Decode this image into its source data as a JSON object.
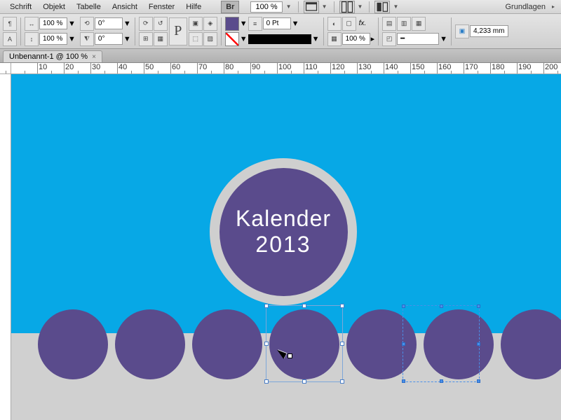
{
  "menu": {
    "items": [
      "Schrift",
      "Objekt",
      "Tabelle",
      "Ansicht",
      "Fenster",
      "Hilfe"
    ],
    "br": "Br",
    "zoom": "100 %",
    "workspace": "Grundlagen"
  },
  "ctrl": {
    "opacity_a": "100 %",
    "opacity_b": "100 %",
    "angle_a": "0°",
    "angle_b": "0°",
    "stroke_pt": "0 Pt",
    "obj_pct": "100 %",
    "dim": "4,233 mm"
  },
  "tab": {
    "name": "Unbenannt-1 @ 100 %",
    "close": "×"
  },
  "ruler": {
    "vals": [
      "",
      "",
      "10",
      "20",
      "30",
      "40",
      "50",
      "60",
      "70",
      "80",
      "90",
      "100",
      "110",
      "120",
      "130",
      "140",
      "150",
      "160",
      "170",
      "180",
      "190",
      "200"
    ]
  },
  "canvas": {
    "title": "Kalender",
    "year": "2013"
  }
}
